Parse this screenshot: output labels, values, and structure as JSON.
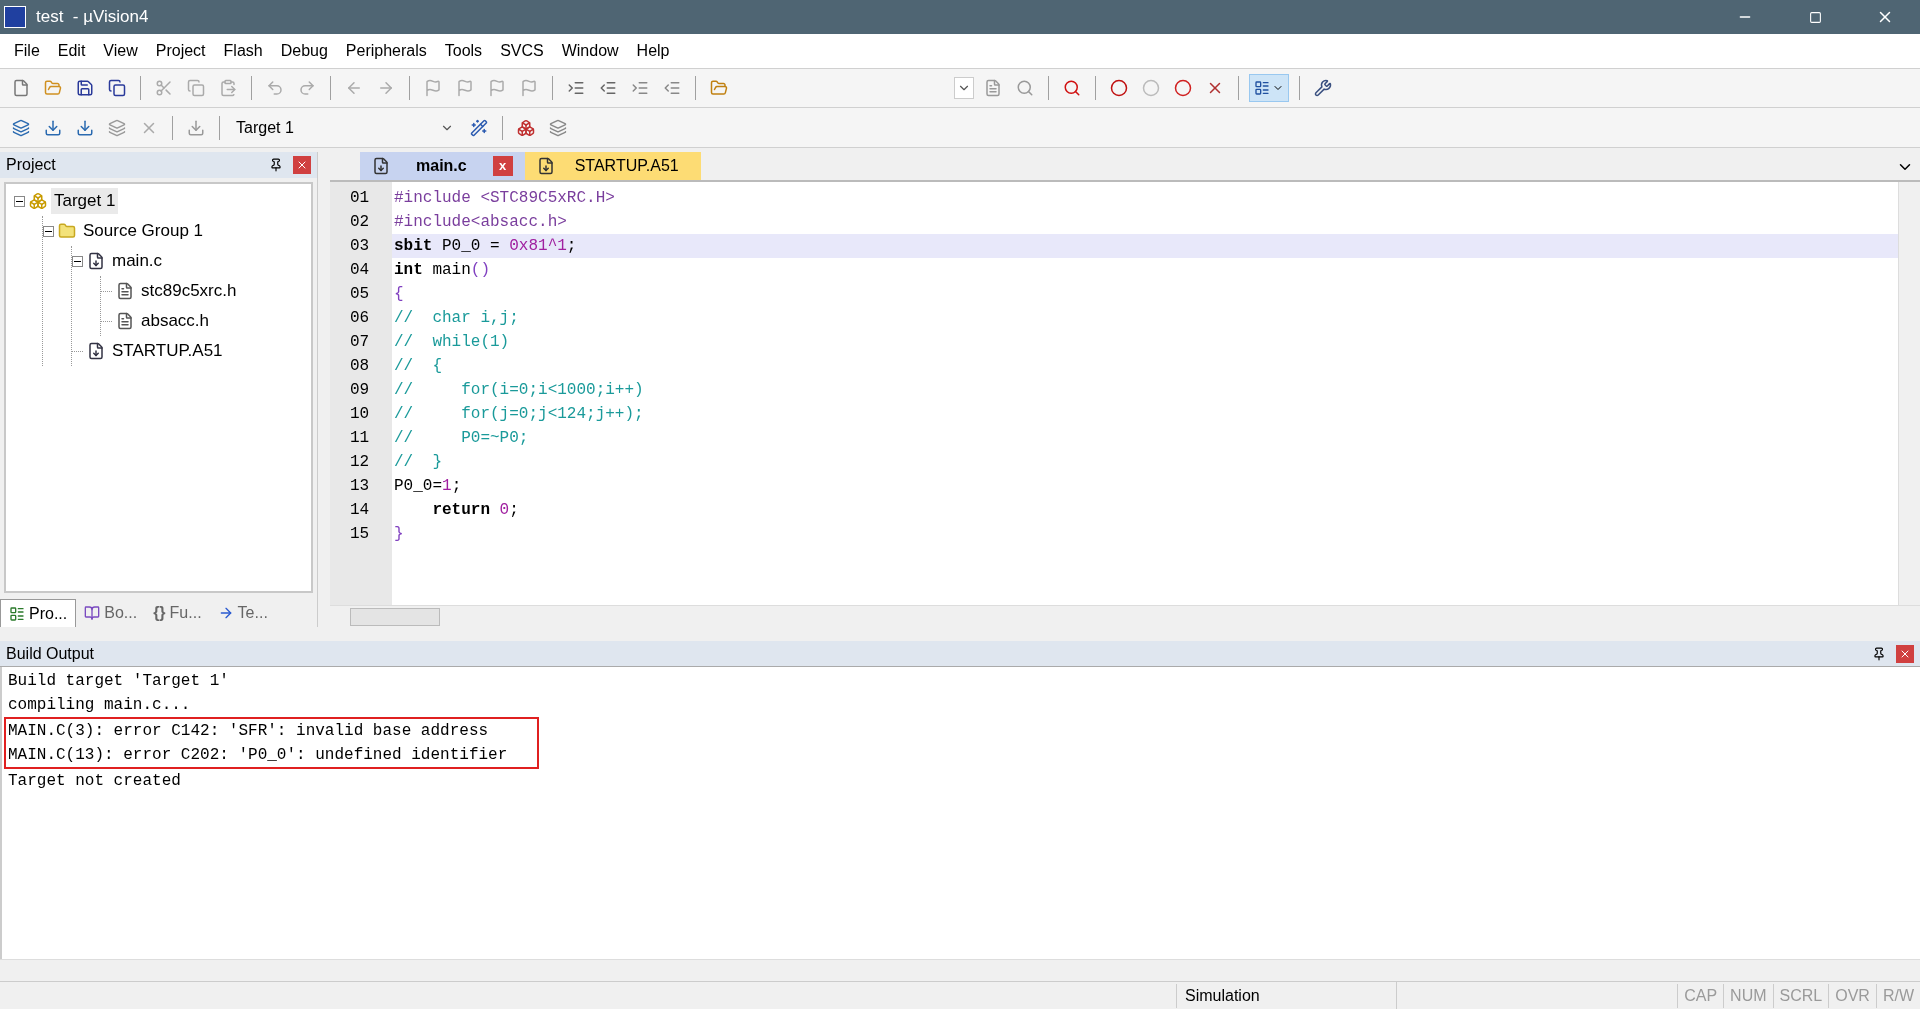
{
  "window": {
    "title": "test  - µVision4"
  },
  "menu": [
    "File",
    "Edit",
    "View",
    "Project",
    "Flash",
    "Debug",
    "Peripherals",
    "Tools",
    "SVCS",
    "Window",
    "Help"
  ],
  "toolbar": {
    "target": "Target 1"
  },
  "project_panel": {
    "title": "Project",
    "tree": [
      {
        "label": "Target 1",
        "kind": "target",
        "selected": true,
        "expanded": true,
        "children": [
          {
            "label": "Source Group 1",
            "kind": "group",
            "selected": false,
            "expanded": true,
            "children": [
              {
                "label": "main.c",
                "kind": "source",
                "selected": false,
                "expanded": true,
                "children": [
                  {
                    "label": "stc89c5xrc.h",
                    "kind": "header",
                    "selected": false
                  },
                  {
                    "label": "absacc.h",
                    "kind": "header",
                    "selected": false
                  }
                ]
              },
              {
                "label": "STARTUP.A51",
                "kind": "source",
                "selected": false
              }
            ]
          }
        ]
      }
    ],
    "tabs": [
      {
        "label": "Pro...",
        "kind": "project",
        "selected": true
      },
      {
        "label": "Bo...",
        "kind": "books",
        "selected": false
      },
      {
        "glyph": "{}",
        "label": "Fu...",
        "kind": "functions",
        "selected": false
      },
      {
        "label": "Te...",
        "kind": "templates",
        "selected": false
      }
    ]
  },
  "editor": {
    "tabs": [
      {
        "label": "main.c",
        "selected": true,
        "close": "x"
      },
      {
        "label": "STARTUP.A51",
        "selected": false
      }
    ],
    "lines": [
      {
        "number": "01",
        "current": false,
        "tokens": [
          {
            "t": "#include <STC89C5xRC.H>",
            "kind": "pre"
          }
        ]
      },
      {
        "number": "02",
        "current": false,
        "tokens": [
          {
            "t": "#include<absacc.h>",
            "kind": "pre"
          }
        ]
      },
      {
        "number": "03",
        "current": true,
        "tokens": [
          {
            "t": "sbit",
            "kind": "kw"
          },
          {
            "t": " P0_0 = ",
            "kind": "plain"
          },
          {
            "t": "0x81^1",
            "kind": "num"
          },
          {
            "t": ";",
            "kind": "plain"
          }
        ]
      },
      {
        "number": "04",
        "current": false,
        "tokens": [
          {
            "t": "int",
            "kind": "kw"
          },
          {
            "t": " main",
            "kind": "plain"
          },
          {
            "t": "()",
            "kind": "op"
          }
        ]
      },
      {
        "number": "05",
        "current": false,
        "tokens": [
          {
            "t": "{",
            "kind": "op"
          }
        ]
      },
      {
        "number": "06",
        "current": false,
        "tokens": [
          {
            "t": "//  char i,j;",
            "kind": "comment"
          }
        ]
      },
      {
        "number": "07",
        "current": false,
        "tokens": [
          {
            "t": "//  while(1)",
            "kind": "comment"
          }
        ]
      },
      {
        "number": "08",
        "current": false,
        "tokens": [
          {
            "t": "//  {",
            "kind": "comment"
          }
        ]
      },
      {
        "number": "09",
        "current": false,
        "tokens": [
          {
            "t": "//     for(i=0;i<1000;i++)",
            "kind": "comment"
          }
        ]
      },
      {
        "number": "10",
        "current": false,
        "tokens": [
          {
            "t": "//     for(j=0;j<124;j++);",
            "kind": "comment"
          }
        ]
      },
      {
        "number": "11",
        "current": false,
        "tokens": [
          {
            "t": "//     P0=~P0;",
            "kind": "comment"
          }
        ]
      },
      {
        "number": "12",
        "current": false,
        "tokens": [
          {
            "t": "//  }",
            "kind": "comment"
          }
        ]
      },
      {
        "number": "13",
        "current": false,
        "tokens": [
          {
            "t": "P0_0=",
            "kind": "plain"
          },
          {
            "t": "1",
            "kind": "num"
          },
          {
            "t": ";",
            "kind": "plain"
          }
        ]
      },
      {
        "number": "14",
        "current": false,
        "tokens": [
          {
            "t": "    return",
            "kind": "kw"
          },
          {
            "t": " 0",
            "kind": "num"
          },
          {
            "t": ";",
            "kind": "plain"
          }
        ]
      },
      {
        "number": "15",
        "current": false,
        "tokens": [
          {
            "t": "}",
            "kind": "op"
          }
        ]
      }
    ]
  },
  "build_output": {
    "title": "Build Output",
    "lines": [
      {
        "text": "Build target 'Target 1'",
        "boxed": false
      },
      {
        "text": "compiling main.c...",
        "boxed": false
      },
      {
        "text": "MAIN.C(3): error C142: 'SFR': invalid base address",
        "boxed": true
      },
      {
        "text": "MAIN.C(13): error C202: 'P0_0': undefined identifier",
        "boxed": true
      },
      {
        "text": "Target not created",
        "boxed": false
      }
    ]
  },
  "status_bar": {
    "mode": "Simulation",
    "indicators": [
      {
        "label": "CAP",
        "disabled": true
      },
      {
        "label": "NUM",
        "disabled": true
      },
      {
        "label": "SCRL",
        "disabled": true
      },
      {
        "label": "OVR",
        "disabled": true
      },
      {
        "label": "R/W",
        "disabled": true
      }
    ]
  }
}
